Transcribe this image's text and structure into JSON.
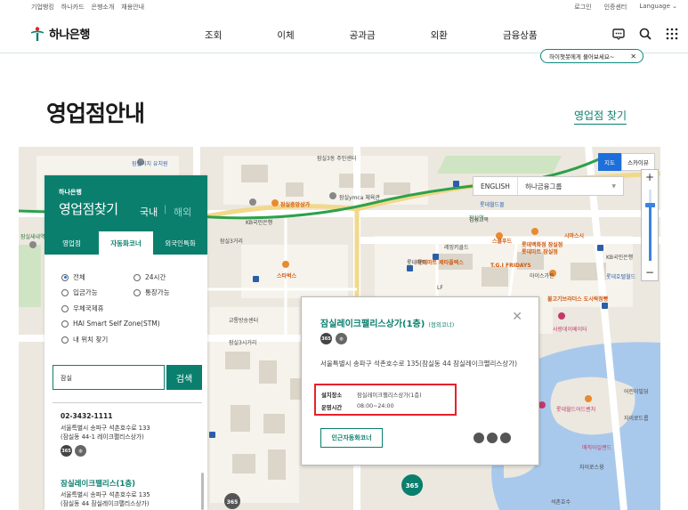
{
  "util_nav": {
    "left": [
      "기업뱅킹",
      "하나카드",
      "은행소개",
      "채용안내"
    ],
    "right": [
      "로그인",
      "인증센터",
      "Language"
    ]
  },
  "logo": {
    "text": "하나은행"
  },
  "menu": [
    "조회",
    "이체",
    "공과금",
    "외환",
    "금융상품"
  ],
  "chat_tip": "하이챗봇에게 물어보세요~",
  "page_title": "영업점안내",
  "find_branch_link": "영업점 찾기",
  "map": {
    "type_toggle": {
      "map": "지도",
      "skyview": "스카이뷰"
    },
    "search": {
      "lang": "ENGLISH",
      "group": "하나금융그룹"
    },
    "labels": [
      "잠실리치 유치원",
      "잠실3동 주민센터",
      "잠실중앙상가",
      "잠실ymca 체육관",
      "KB국민은행",
      "잠실3거리",
      "잠실새내역",
      "잠실역",
      "롯데마트 제타플렉스",
      "롯데월드몰",
      "교통방송센터",
      "잠실3시거리",
      "T.G.I FRIDAYS",
      "레밍키클드",
      "스쿨푸드",
      "롯데백화점 잠실점",
      "시마스시",
      "KB국민은행",
      "아이스가든",
      "롯데호텔월드",
      "불고기브라더스 도시락점빵",
      "사랑데이베이터",
      "어린이빌딩",
      "롯데월드어드벤처",
      "매직아일랜드",
      "자이로스윙",
      "석촌호수",
      "김성교복",
      "롯데마트",
      "LF",
      "스타벅스",
      "자이로드롭",
      "롯데마트 잠실점"
    ]
  },
  "panel": {
    "brand": "하나은행",
    "title": "영업점찾기",
    "domestic": "국내",
    "overseas": "해외",
    "tabs": [
      "영업점",
      "자동화코너",
      "외국인특화"
    ],
    "options": {
      "all": "전체",
      "h24": "24시간",
      "deposit": "입금가능",
      "passbook": "통장가능",
      "postal": "우체국제휴",
      "stm": "HAI Smart Self Zone(STM)",
      "myloc": "내 위치 찾기"
    },
    "search_value": "잠실",
    "search_button": "검색",
    "results": [
      {
        "phone": "02-3432-1111",
        "addr1": "서울특별시 송파구 석촌호수로 133",
        "addr2": "(잠실동 44-1 레이크팰리스상가)"
      },
      {
        "name": "잠실레이크팰리스(1층)",
        "addr1": "서울특별시 송파구 석촌호수로 135",
        "addr2": "(잠실동 44 잠실레이크팰리스상가)"
      }
    ]
  },
  "card": {
    "name": "잠실레이크팰리스상가(1층)",
    "tag": "(점외코너)",
    "address": "서울특별시 송파구 석촌호수로 135(잠실동 44 잠실레이크팰리스상가)",
    "place_key": "설치장소",
    "place_val": "잠실레이크팰리스상가(1층)",
    "hours_key": "운영시간",
    "hours_val": "08:00~24:00",
    "nearby_button": "인근자동화코너",
    "badge_365": "365"
  },
  "colors": {
    "brand": "#0b7f6e",
    "highlight": "#e6212b",
    "map_blue": "#1e6fd9"
  }
}
